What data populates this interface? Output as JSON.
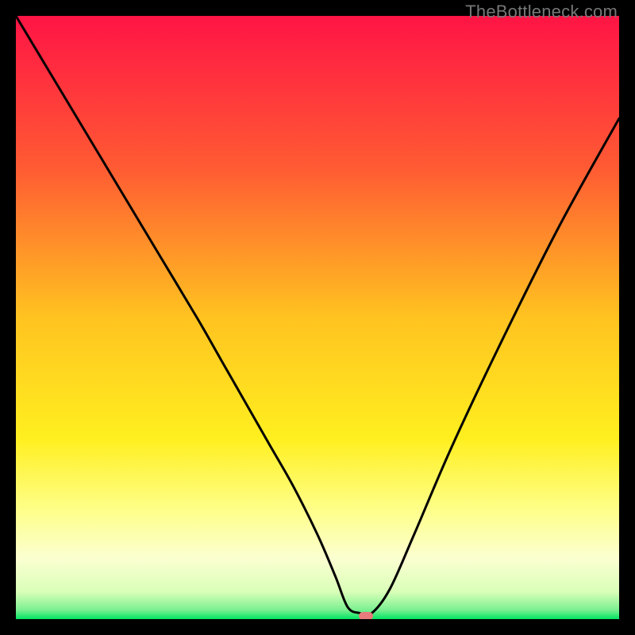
{
  "watermark": "TheBottleneck.com",
  "chart_data": {
    "type": "line",
    "title": "",
    "xlabel": "",
    "ylabel": "",
    "xlim": [
      0,
      100
    ],
    "ylim": [
      0,
      100
    ],
    "gradient_stops": [
      {
        "offset": 0,
        "color": "#ff1445"
      },
      {
        "offset": 0.25,
        "color": "#ff5a33"
      },
      {
        "offset": 0.5,
        "color": "#ffc320"
      },
      {
        "offset": 0.7,
        "color": "#ffef1f"
      },
      {
        "offset": 0.82,
        "color": "#feff8a"
      },
      {
        "offset": 0.9,
        "color": "#fbffd1"
      },
      {
        "offset": 0.955,
        "color": "#d9ffb8"
      },
      {
        "offset": 0.985,
        "color": "#7af091"
      },
      {
        "offset": 1.0,
        "color": "#00e463"
      }
    ],
    "series": [
      {
        "name": "bottleneck-curve",
        "x": [
          0,
          6,
          12,
          18,
          24,
          30,
          34,
          38,
          42,
          46,
          50,
          53,
          55,
          57,
          59,
          62,
          66,
          72,
          80,
          90,
          100
        ],
        "y": [
          100,
          90,
          80,
          70,
          60,
          50,
          43,
          36,
          29,
          22,
          14,
          7,
          2,
          1,
          1,
          5,
          14,
          28,
          45,
          65,
          83
        ]
      }
    ],
    "marker": {
      "x": 58,
      "y": 0.5,
      "color": "#e87b7b"
    },
    "grid": false,
    "legend": false
  }
}
